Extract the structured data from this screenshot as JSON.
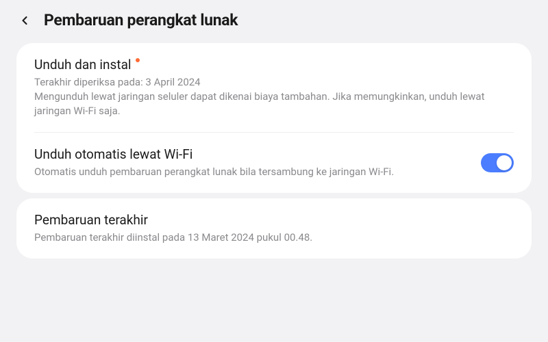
{
  "header": {
    "title": "Pembaruan perangkat lunak"
  },
  "download_install": {
    "title": "Unduh dan instal",
    "last_checked": "Terakhir diperiksa pada: 3 April 2024",
    "warning": "Mengunduh lewat jaringan seluler dapat dikenai biaya tambahan. Jika memungkinkan, unduh lewat jaringan Wi-Fi saja.",
    "has_update": true
  },
  "auto_download": {
    "title": "Unduh otomatis lewat Wi-Fi",
    "description": "Otomatis unduh pembaruan perangkat lunak bila tersambung ke jaringan Wi-Fi.",
    "enabled": true
  },
  "last_update": {
    "title": "Pembaruan terakhir",
    "description": "Pembaruan terakhir diinstal pada 13 Maret 2024 pukul 00.48."
  }
}
